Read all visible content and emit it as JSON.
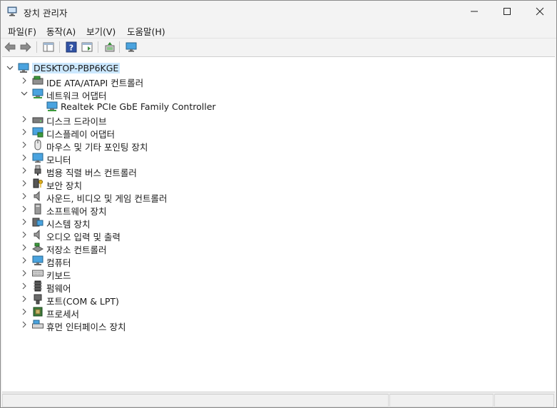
{
  "window": {
    "title": "장치 관리자"
  },
  "menu": [
    "파일(F)",
    "동작(A)",
    "보기(V)",
    "도움말(H)"
  ],
  "toolbar": [
    "back-icon",
    "forward-icon",
    "show-hide-tree-icon",
    "help-icon",
    "properties-icon",
    "update-driver-icon",
    "scan-hardware-icon"
  ],
  "tree": {
    "root": "DESKTOP-PBP6KGE",
    "items": [
      {
        "label": "IDE ATA/ATAPI 컨트롤러",
        "icon": "ide-controller-icon",
        "expanded": false
      },
      {
        "label": "네트워크 어댑터",
        "icon": "network-adapter-icon",
        "expanded": true,
        "children": [
          {
            "label": "Realtek PCIe GbE Family Controller",
            "icon": "network-adapter-icon"
          }
        ]
      },
      {
        "label": "디스크 드라이브",
        "icon": "disk-drive-icon",
        "expanded": false
      },
      {
        "label": "디스플레이 어댑터",
        "icon": "display-adapter-icon",
        "expanded": false
      },
      {
        "label": "마우스 및 기타 포인팅 장치",
        "icon": "mouse-icon",
        "expanded": false
      },
      {
        "label": "모니터",
        "icon": "monitor-icon",
        "expanded": false
      },
      {
        "label": "범용 직렬 버스 컨트롤러",
        "icon": "usb-icon",
        "expanded": false
      },
      {
        "label": "보안 장치",
        "icon": "security-device-icon",
        "expanded": false
      },
      {
        "label": "사운드, 비디오 및 게임 컨트롤러",
        "icon": "speaker-icon",
        "expanded": false
      },
      {
        "label": "소프트웨어 장치",
        "icon": "software-device-icon",
        "expanded": false
      },
      {
        "label": "시스템 장치",
        "icon": "system-device-icon",
        "expanded": false
      },
      {
        "label": "오디오 입력 및 출력",
        "icon": "audio-io-icon",
        "expanded": false
      },
      {
        "label": "저장소 컨트롤러",
        "icon": "storage-controller-icon",
        "expanded": false
      },
      {
        "label": "컴퓨터",
        "icon": "computer-icon",
        "expanded": false
      },
      {
        "label": "키보드",
        "icon": "keyboard-icon",
        "expanded": false
      },
      {
        "label": "펌웨어",
        "icon": "firmware-icon",
        "expanded": false
      },
      {
        "label": "포트(COM & LPT)",
        "icon": "port-icon",
        "expanded": false
      },
      {
        "label": "프로세서",
        "icon": "processor-icon",
        "expanded": false
      },
      {
        "label": "휴먼 인터페이스 장치",
        "icon": "hid-icon",
        "expanded": false
      }
    ]
  }
}
